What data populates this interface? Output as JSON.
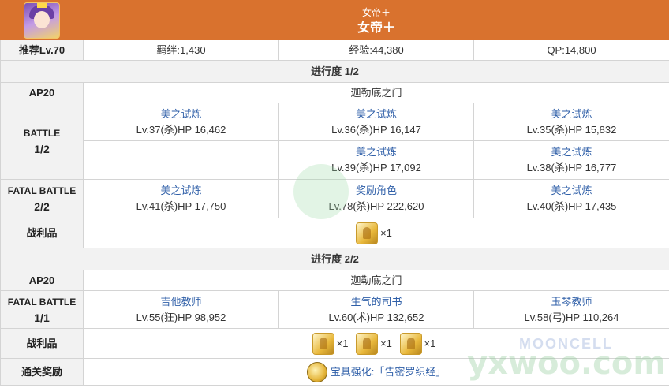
{
  "header": {
    "subtitle": "女帝＋",
    "title": "女帝＋"
  },
  "info": {
    "level": "推荐Lv.70",
    "bond": "羁绊:1,430",
    "exp": "经验:44,380",
    "qp": "QP:14,800"
  },
  "sections": [
    {
      "progress": "进行度 1/2",
      "ap": "AP20",
      "location": "迦勒底之门",
      "battle_label_line1": "BATTLE",
      "battle_label_line2": "1/2",
      "battle_row1": [
        {
          "name": "美之试炼",
          "stats": "Lv.37(杀)HP 16,462"
        },
        {
          "name": "美之试炼",
          "stats": "Lv.36(杀)HP 16,147"
        },
        {
          "name": "美之试炼",
          "stats": "Lv.35(杀)HP 15,832"
        }
      ],
      "battle_row2": [
        {
          "name": "美之试炼",
          "stats": "Lv.39(杀)HP 17,092"
        },
        {
          "name": "美之试炼",
          "stats": "Lv.38(杀)HP 16,777"
        }
      ],
      "fatal_label_line1": "FATAL BATTLE",
      "fatal_label_line2": "2/2",
      "fatal_row": [
        {
          "name": "美之试炼",
          "stats": "Lv.41(杀)HP 17,750"
        },
        {
          "name": "奖励角色",
          "stats": "Lv.78(杀)HP 222,620"
        },
        {
          "name": "美之试炼",
          "stats": "Lv.40(杀)HP 17,435"
        }
      ],
      "loot_label": "战利品",
      "loot": [
        {
          "icon": "gold-statue-icon",
          "qty": "×1"
        }
      ]
    },
    {
      "progress": "进行度 2/2",
      "ap": "AP20",
      "location": "迦勒底之门",
      "fatal_label_line1": "FATAL BATTLE",
      "fatal_label_line2": "1/1",
      "fatal_row": [
        {
          "name": "吉他教师",
          "stats": "Lv.55(狂)HP 98,952"
        },
        {
          "name": "生气的司书",
          "stats": "Lv.60(术)HP 132,652"
        },
        {
          "name": "玉琴教师",
          "stats": "Lv.58(弓)HP 110,264"
        }
      ],
      "loot_label": "战利品",
      "loot": [
        {
          "icon": "gold-statue-icon",
          "qty": "×1"
        },
        {
          "icon": "gold-statue-icon",
          "qty": "×1"
        },
        {
          "icon": "gold-statue-icon",
          "qty": "×1"
        }
      ],
      "clear_label": "通关奖励",
      "clear_reward": "宝具强化:「告密罗织经」"
    }
  ],
  "watermark": {
    "site": "yxwoo.com",
    "brand": "MOONCELL"
  },
  "colors": {
    "header_bg": "#d9722e",
    "label_bg": "#f2f2f2",
    "link": "#2f5fa8"
  }
}
